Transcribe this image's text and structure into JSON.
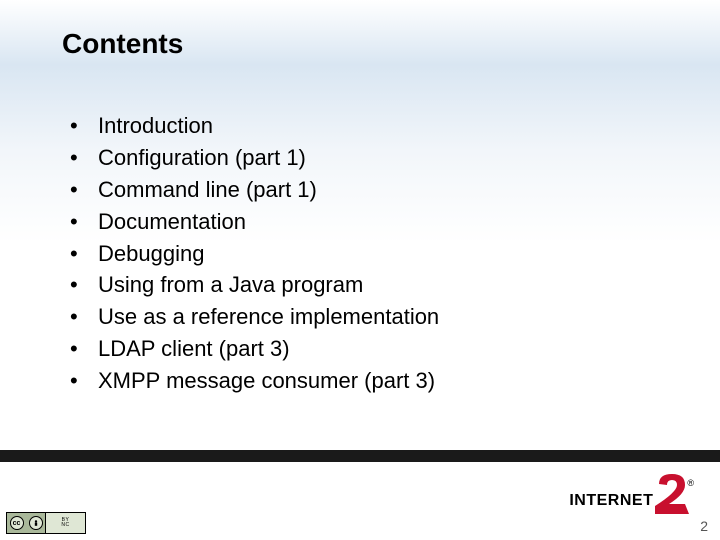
{
  "title": "Contents",
  "bullets": [
    "Introduction",
    "Configuration (part 1)",
    "Command line (part 1)",
    "Documentation",
    "Debugging",
    "Using from a Java program",
    "Use as a reference implementation",
    "LDAP client (part 3)",
    "XMPP message consumer (part 3)"
  ],
  "page_number": "2",
  "logo": {
    "text": "INTERNET",
    "reg": "®"
  },
  "cc": {
    "label_top": "BY",
    "label_bottom": "NC"
  }
}
